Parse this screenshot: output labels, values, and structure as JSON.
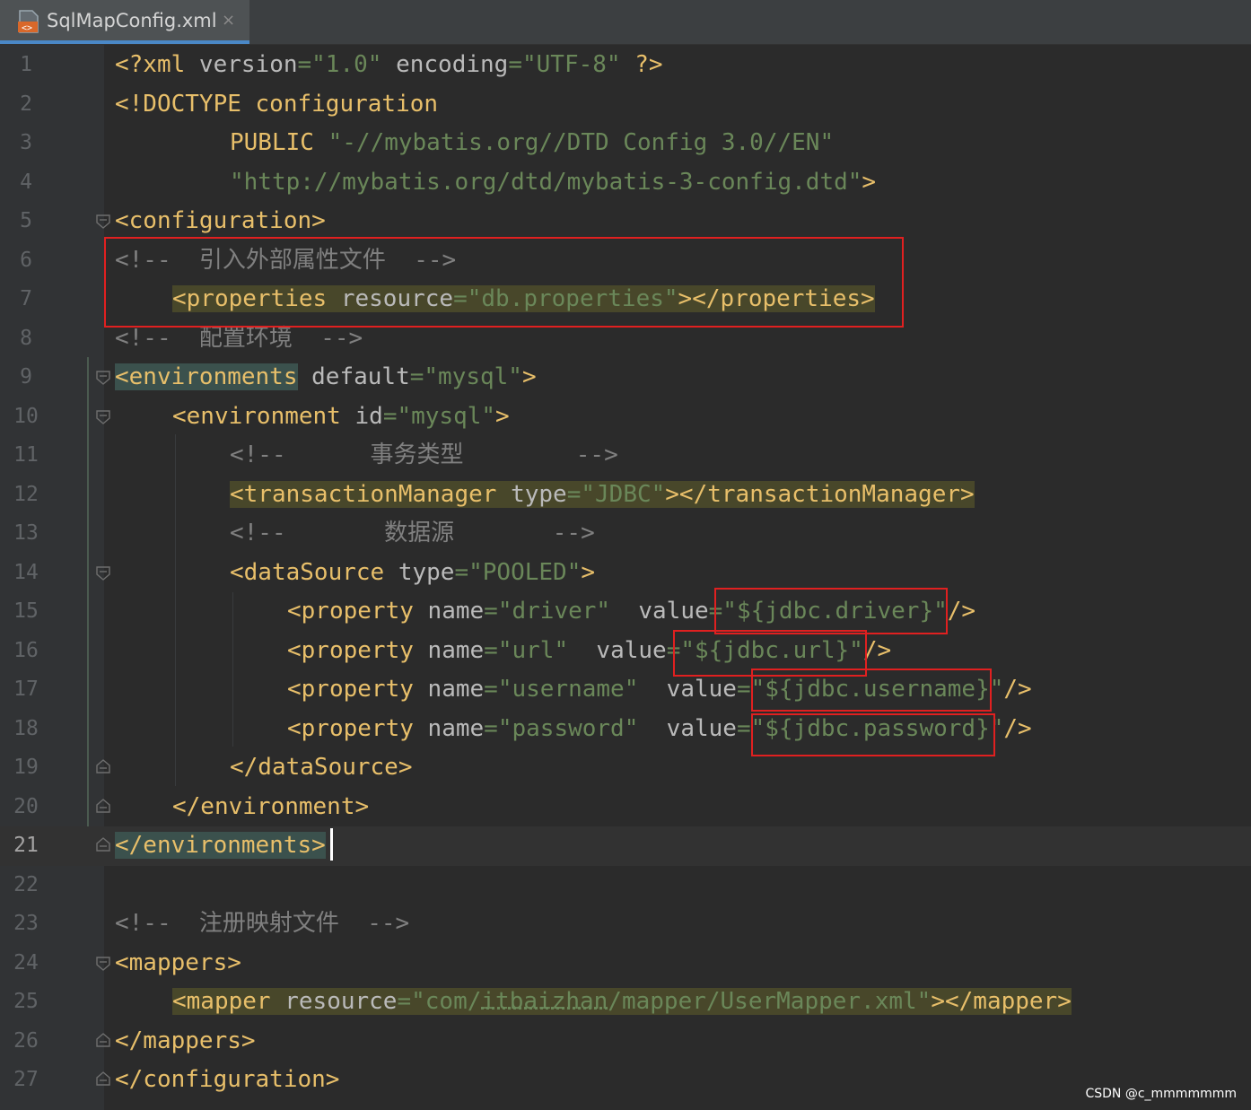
{
  "tab": {
    "file_name": "SqlMapConfig.xml",
    "close_glyph": "×",
    "icon": "xml-file-icon"
  },
  "editor": {
    "active_line": 21,
    "lines": [
      {
        "n": "1"
      },
      {
        "n": "2"
      },
      {
        "n": "3"
      },
      {
        "n": "4"
      },
      {
        "n": "5"
      },
      {
        "n": "6"
      },
      {
        "n": "7"
      },
      {
        "n": "8"
      },
      {
        "n": "9"
      },
      {
        "n": "10"
      },
      {
        "n": "11"
      },
      {
        "n": "12"
      },
      {
        "n": "13"
      },
      {
        "n": "14"
      },
      {
        "n": "15"
      },
      {
        "n": "16"
      },
      {
        "n": "17"
      },
      {
        "n": "18"
      },
      {
        "n": "19"
      },
      {
        "n": "20"
      },
      {
        "n": "21"
      },
      {
        "n": "22"
      },
      {
        "n": "23"
      },
      {
        "n": "24"
      },
      {
        "n": "25"
      },
      {
        "n": "26"
      },
      {
        "n": "27"
      }
    ],
    "code": {
      "l1": {
        "open": "<?xml ",
        "attr1": "version",
        "eq1": "=",
        "val1": "\"1.0\"",
        "sp": " ",
        "attr2": "encoding",
        "eq2": "=",
        "val2": "\"UTF-8\"",
        "close": " ?>"
      },
      "l2": {
        "open": "<!DOCTYPE configuration"
      },
      "l3": {
        "text": "PUBLIC ",
        "val": "\"-//mybatis.org//DTD Config 3.0//EN\""
      },
      "l4": {
        "val": "\"http://mybatis.org/dtd/mybatis-3-config.dtd\"",
        "close": ">"
      },
      "l5": {
        "tag": "<configuration>"
      },
      "l6": {
        "comment": "<!--  引入外部属性文件  -->"
      },
      "l7": {
        "tag_open": "<properties",
        "attr": " resource",
        "eq": "=",
        "val": "\"db.properties\"",
        "tag_close": "></properties>"
      },
      "l8": {
        "comment": "<!--  配置环境  -->"
      },
      "l9": {
        "tag_open": "<environments",
        "attr": " default",
        "eq": "=",
        "val": "\"mysql\"",
        "tag_close": ">"
      },
      "l10": {
        "tag_open": "<environment",
        "attr": " id",
        "eq": "=",
        "val": "\"mysql\"",
        "tag_close": ">"
      },
      "l11": {
        "comment": "<!--      事务类型        -->"
      },
      "l12": {
        "tag_open": "<transactionManager",
        "attr": " type",
        "eq": "=",
        "val": "\"JDBC\"",
        "tag_close": "></transactionManager>"
      },
      "l13": {
        "comment": "<!--       数据源       -->"
      },
      "l14": {
        "tag_open": "<dataSource",
        "attr": " type",
        "eq": "=",
        "val": "\"POOLED\"",
        "tag_close": ">"
      },
      "l15": {
        "tag_open": "<property",
        "attr1": " name",
        "eq1": "=",
        "val1": "\"driver\"",
        "attr2": "  value",
        "eq2": "=",
        "val2": "\"${jdbc.driver}\"",
        "tag_close": "/>"
      },
      "l16": {
        "tag_open": "<property",
        "attr1": " name",
        "eq1": "=",
        "val1": "\"url\"",
        "attr2": "  value",
        "eq2": "=",
        "val2": "\"${jdbc.url}\"",
        "tag_close": "/>"
      },
      "l17": {
        "tag_open": "<property",
        "attr1": " name",
        "eq1": "=",
        "val1": "\"username\"",
        "attr2": "  value",
        "eq2": "=",
        "val2": "\"${jdbc.username}\"",
        "tag_close": "/>"
      },
      "l18": {
        "tag_open": "<property",
        "attr1": " name",
        "eq1": "=",
        "val1": "\"password\"",
        "attr2": "  value",
        "eq2": "=",
        "val2": "\"${jdbc.password}\"",
        "tag_close": "/>"
      },
      "l19": {
        "tag": "</dataSource>"
      },
      "l20": {
        "tag": "</environment>"
      },
      "l21": {
        "tag": "</environments",
        "tag_end": ">"
      },
      "l23": {
        "comment": "<!--  注册映射文件  -->"
      },
      "l24": {
        "tag": "<mappers>"
      },
      "l25": {
        "tag_open": "<mapper",
        "attr": " resource",
        "eq": "=",
        "val_a": "\"com/",
        "val_b": "itbaizhan",
        "val_c": "/mapper/UserMapper.xml\"",
        "tag_close": "></mapper>"
      },
      "l26": {
        "tag": "</mappers>"
      },
      "l27": {
        "tag": "</configuration>"
      }
    }
  },
  "watermark": "CSDN @c_mmmmmmm",
  "colors": {
    "background": "#2b2b2b",
    "gutter": "#313335",
    "tag": "#e8bf6a",
    "attribute": "#bababa",
    "value": "#6a8759",
    "comment": "#808080",
    "annotation_box": "#e02020"
  }
}
